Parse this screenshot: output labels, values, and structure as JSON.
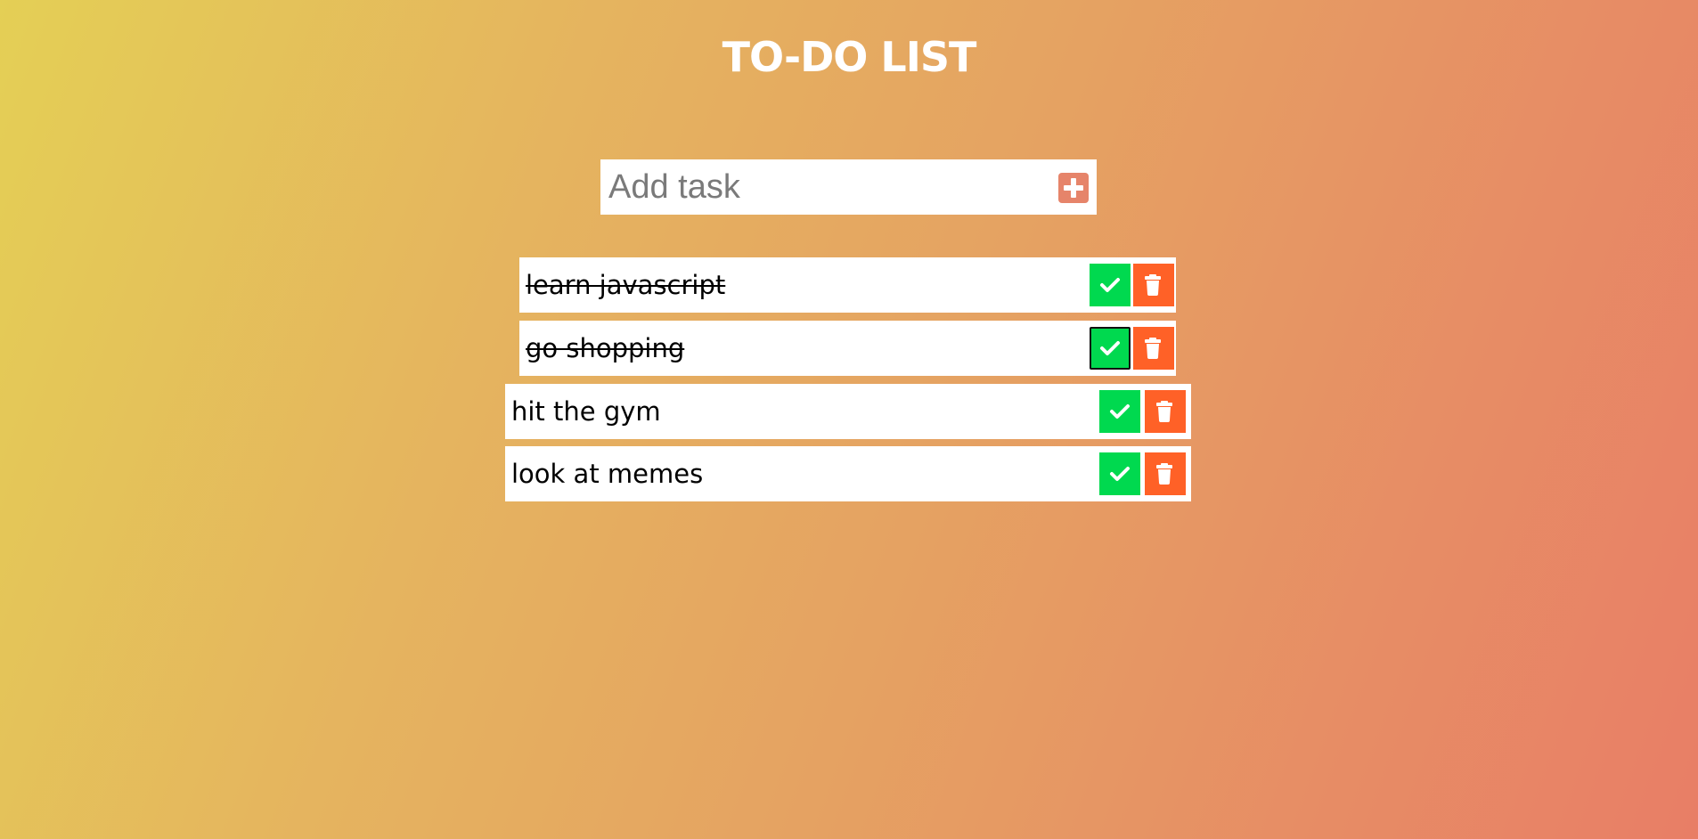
{
  "header": {
    "title": "TO-DO LIST"
  },
  "add_task": {
    "placeholder": "Add task",
    "value": "",
    "button_icon": "plus-square-icon",
    "button_color": "#e6846a"
  },
  "tasks": [
    {
      "text": "learn javascript",
      "completed": true
    },
    {
      "text": "go shopping",
      "completed": true
    },
    {
      "text": "hit the gym",
      "completed": false
    },
    {
      "text": "look at memes",
      "completed": false
    }
  ],
  "icons": {
    "complete": "check-icon",
    "delete": "trash-icon"
  },
  "colors": {
    "complete_button": "#00d94f",
    "delete_button": "#ff6127",
    "title": "#ffffff",
    "gradient_start": "#e4cf55",
    "gradient_end": "#e87e66"
  }
}
